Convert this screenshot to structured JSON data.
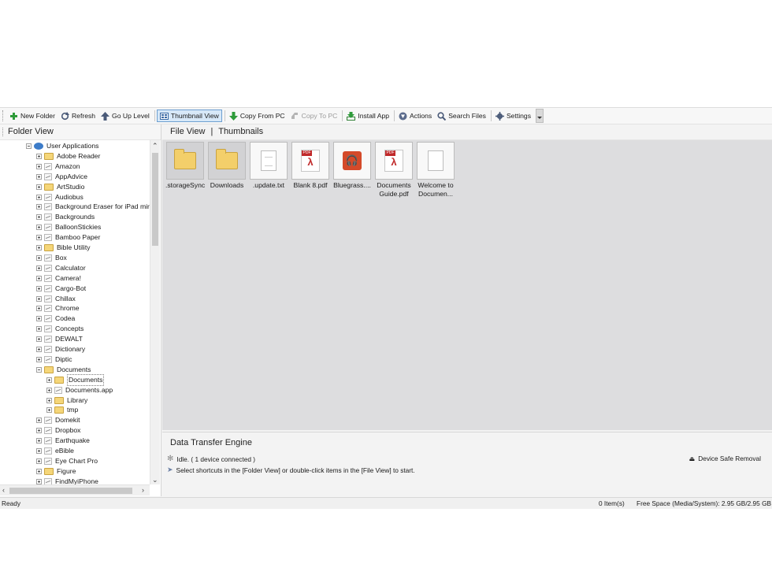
{
  "toolbar": {
    "new_folder": "New Folder",
    "refresh": "Refresh",
    "go_up": "Go Up Level",
    "thumbnail_view": "Thumbnail View",
    "copy_from_pc": "Copy From PC",
    "copy_to_pc": "Copy To PC",
    "install_app": "Install App",
    "actions": "Actions",
    "search_files": "Search Files",
    "settings": "Settings"
  },
  "folder_view": {
    "title": "Folder View",
    "items": [
      {
        "label": "User Applications",
        "level": 0,
        "icon": "device-icon",
        "expanded": true
      },
      {
        "label": "Adobe Reader",
        "level": 1,
        "icon": "folder-icon"
      },
      {
        "label": "Amazon",
        "level": 1,
        "icon": "app-icon"
      },
      {
        "label": "AppAdvice",
        "level": 1,
        "icon": "app-icon"
      },
      {
        "label": "ArtStudio",
        "level": 1,
        "icon": "folder-icon"
      },
      {
        "label": "Audiobus",
        "level": 1,
        "icon": "app-icon"
      },
      {
        "label": "Background Eraser for iPad mir",
        "level": 1,
        "icon": "app-icon"
      },
      {
        "label": "Backgrounds",
        "level": 1,
        "icon": "app-icon"
      },
      {
        "label": "BalloonStickies",
        "level": 1,
        "icon": "app-icon"
      },
      {
        "label": "Bamboo Paper",
        "level": 1,
        "icon": "app-icon"
      },
      {
        "label": "Bible Utility",
        "level": 1,
        "icon": "folder-icon"
      },
      {
        "label": "Box",
        "level": 1,
        "icon": "app-icon"
      },
      {
        "label": "Calculator",
        "level": 1,
        "icon": "app-icon"
      },
      {
        "label": "Camera!",
        "level": 1,
        "icon": "app-icon"
      },
      {
        "label": "Cargo-Bot",
        "level": 1,
        "icon": "app-icon"
      },
      {
        "label": "Chillax",
        "level": 1,
        "icon": "app-icon"
      },
      {
        "label": "Chrome",
        "level": 1,
        "icon": "app-icon"
      },
      {
        "label": "Codea",
        "level": 1,
        "icon": "app-icon"
      },
      {
        "label": "Concepts",
        "level": 1,
        "icon": "app-icon"
      },
      {
        "label": "DEWALT",
        "level": 1,
        "icon": "app-icon"
      },
      {
        "label": "Dictionary",
        "level": 1,
        "icon": "app-icon"
      },
      {
        "label": "Diptic",
        "level": 1,
        "icon": "app-icon"
      },
      {
        "label": "Documents",
        "level": 1,
        "icon": "folder-icon",
        "expanded": true
      },
      {
        "label": "Documents",
        "level": 2,
        "icon": "folder-icon",
        "selected": true
      },
      {
        "label": "Documents.app",
        "level": 2,
        "icon": "app-icon"
      },
      {
        "label": "Library",
        "level": 2,
        "icon": "folder-icon"
      },
      {
        "label": "tmp",
        "level": 2,
        "icon": "folder-icon"
      },
      {
        "label": "Domekit",
        "level": 1,
        "icon": "app-icon"
      },
      {
        "label": "Dropbox",
        "level": 1,
        "icon": "app-icon"
      },
      {
        "label": "Earthquake",
        "level": 1,
        "icon": "app-icon"
      },
      {
        "label": "eBible",
        "level": 1,
        "icon": "app-icon"
      },
      {
        "label": "Eye Chart Pro",
        "level": 1,
        "icon": "app-icon"
      },
      {
        "label": "Figure",
        "level": 1,
        "icon": "folder-icon"
      },
      {
        "label": "FindMyiPhone",
        "level": 1,
        "icon": "app-icon"
      }
    ]
  },
  "file_view": {
    "title": "File View",
    "separator": "|",
    "mode": "Thumbnails",
    "files": [
      {
        "caption": ".storageSync",
        "type": "folder"
      },
      {
        "caption": "Downloads",
        "type": "folder"
      },
      {
        "caption": ".update.txt",
        "type": "text"
      },
      {
        "caption": "Blank 8.pdf",
        "type": "pdf"
      },
      {
        "caption": "Bluegrass....",
        "type": "audio"
      },
      {
        "caption": "Documents Guide.pdf",
        "type": "pdf"
      },
      {
        "caption": "Welcome to Documen...",
        "type": "doc"
      }
    ]
  },
  "transfer": {
    "title": "Data Transfer Engine",
    "status": "Idle. ( 1 device connected )",
    "hint": "Select shortcuts in the [Folder View] or double-click items in the [File View] to start.",
    "safe_removal": "Device Safe Removal"
  },
  "statusbar": {
    "ready": "Ready",
    "items": "0 Item(s)",
    "free_space": "Free Space (Media/System): 2.95 GB/2.95 GB"
  },
  "colors": {
    "accent": "#6d9fd0",
    "pdf_red": "#c0292a",
    "folder_yellow": "#f3cf6a",
    "file_area_bg": "#dddddf"
  }
}
